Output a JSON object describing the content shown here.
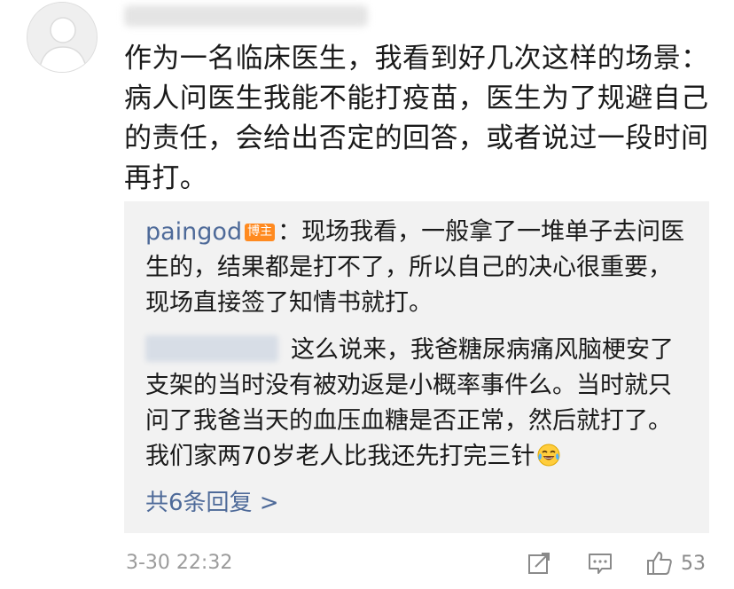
{
  "comment": {
    "text": "作为一名临床医生，我看到好几次这样的场景：病人问医生我能不能打疫苗，医生为了规避自己的责任，会给出否定的回答，或者说过一段时间再打。",
    "timestamp": "3-30 22:32",
    "like_count": "53"
  },
  "replies": [
    {
      "author": "paingod",
      "badge": "博主",
      "text": "：现场我看，一般拿了一堆单子去问医生的，结果都是打不了，所以自己的决心很重要，现场直接签了知情书就打。"
    },
    {
      "text": "这么说来，我爸糖尿病痛风脑梗安了支架的当时没有被劝返是小概率事件么。当时就只问了我爸当天的血压血糖是否正常，然后就打了。我们家两70岁老人比我还先打完三针",
      "emoji": "tears-of-joy-emoji"
    }
  ],
  "more_replies": "共6条回复 >",
  "icons": {
    "share": "share-icon",
    "comment": "comment-icon",
    "like": "thumbs-up-icon"
  },
  "colors": {
    "link": "#4e6a99",
    "badge": "#ff8a20",
    "reply_background": "#f2f2f2",
    "meta": "#9b9b9b"
  }
}
